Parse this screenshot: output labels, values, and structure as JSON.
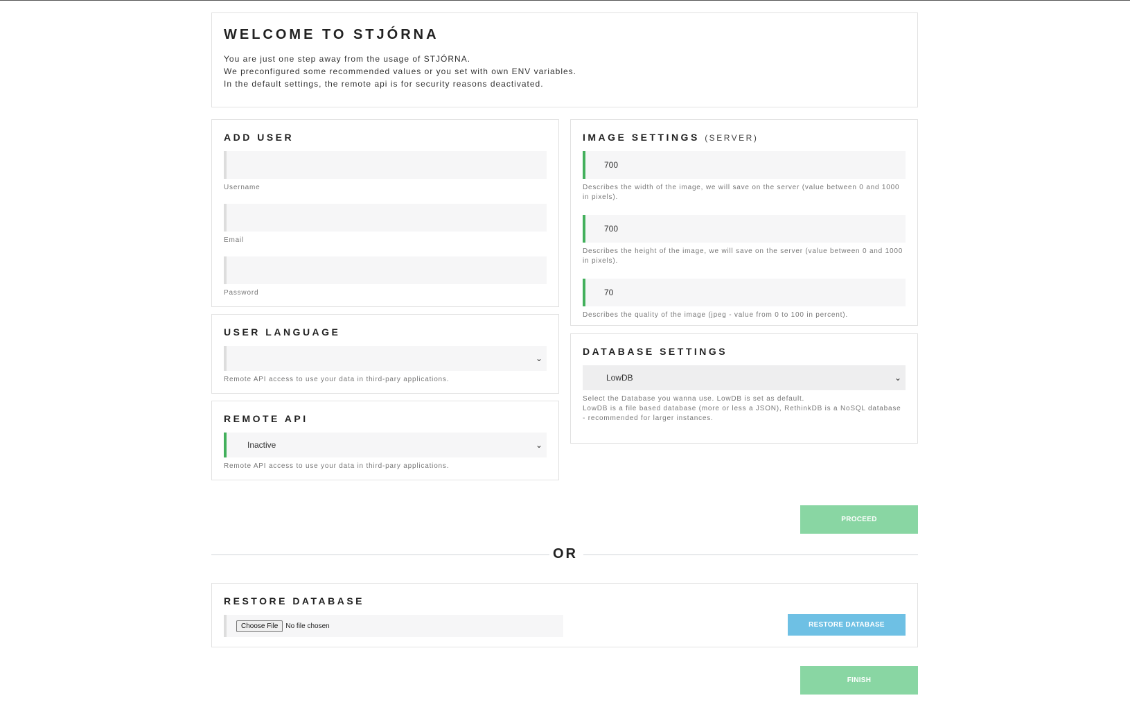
{
  "welcome": {
    "title": "WELCOME TO STJÓRNA",
    "lines": [
      "You are just one step away from the usage of STJÓRNA.",
      "We preconfigured some recommended values or you set with own ENV variables.",
      "In the default settings, the remote api is for security reasons deactivated."
    ]
  },
  "add_user": {
    "title": "ADD USER",
    "username": {
      "value": "",
      "hint": "Username"
    },
    "email": {
      "value": "",
      "hint": "Email"
    },
    "password": {
      "value": "",
      "hint": "Password"
    }
  },
  "user_language": {
    "title": "USER LANGUAGE",
    "selected": "",
    "hint": "Remote API access to use your data in third-pary applications."
  },
  "remote_api": {
    "title": "REMOTE API",
    "selected": "Inactive",
    "hint": "Remote API access to use your data in third-pary applications."
  },
  "image_settings": {
    "title": "IMAGE SETTINGS",
    "subtitle": "(SERVER)",
    "width": {
      "value": "700",
      "hint": "Describes the width of the image, we will save on the server (value between 0 and 1000 in pixels)."
    },
    "height": {
      "value": "700",
      "hint": "Describes the height of the image, we will save on the server (value between 0 and 1000 in pixels)."
    },
    "quality": {
      "value": "70",
      "hint": "Describes the quality of the image (jpeg - value from 0 to 100 in percent)."
    }
  },
  "database_settings": {
    "title": "DATABASE SETTINGS",
    "selected": "LowDB",
    "hint_lines": [
      "Select the Database you wanna use. LowDB is set as default.",
      "LowDB is a file based database (more or less a JSON), RethinkDB is a NoSQL database - recommended for larger instances."
    ]
  },
  "proceed_label": "PROCEED",
  "or_label": "OR",
  "restore": {
    "title": "RESTORE DATABASE",
    "choose_label": "Choose File",
    "no_file": "No file chosen",
    "button_label": "RESTORE DATABASE"
  },
  "finish_label": "FINISH",
  "colors": {
    "accent_green": "#43b05c",
    "button_green": "#89d6a3",
    "button_blue": "#6ec0e4"
  },
  "icons": {
    "select_chevron": "chevron-down-icon"
  }
}
